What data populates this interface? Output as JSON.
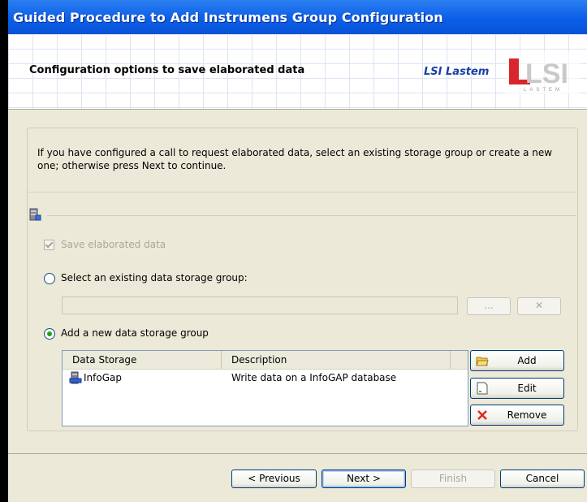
{
  "window": {
    "title": "Guided Procedure to Add Instrumens Group Configuration"
  },
  "header": {
    "title": "Configuration options to save elaborated data",
    "brand_text": "LSI Lastem",
    "logo_text": "LSI",
    "logo_subtext": "LASTEM"
  },
  "intro": {
    "text": "If you have configured a call to request elaborated data, select an existing storage group or create a new one; otherwise press Next to continue."
  },
  "options": {
    "save_elaborated_label": "Save elaborated data",
    "save_elaborated_checked": true,
    "select_existing_label": "Select an existing data storage group:",
    "select_existing_value": "",
    "browse_label": "...",
    "clear_label": "✕",
    "add_new_label": "Add a new data storage group",
    "selected_option": "add_new"
  },
  "storage_list": {
    "columns": [
      "Data Storage",
      "Description"
    ],
    "rows": [
      {
        "name": "InfoGap",
        "description": "Write data on a InfoGAP database"
      }
    ]
  },
  "side_buttons": {
    "add": "Add",
    "edit": "Edit",
    "remove": "Remove"
  },
  "footer": {
    "previous": "< Previous",
    "next": "Next >",
    "finish": "Finish",
    "cancel": "Cancel"
  },
  "colors": {
    "titlebar": "#0c5ee8",
    "brand": "#163fa8",
    "logo_red": "#d8262c",
    "radio_dot": "#21a121"
  }
}
